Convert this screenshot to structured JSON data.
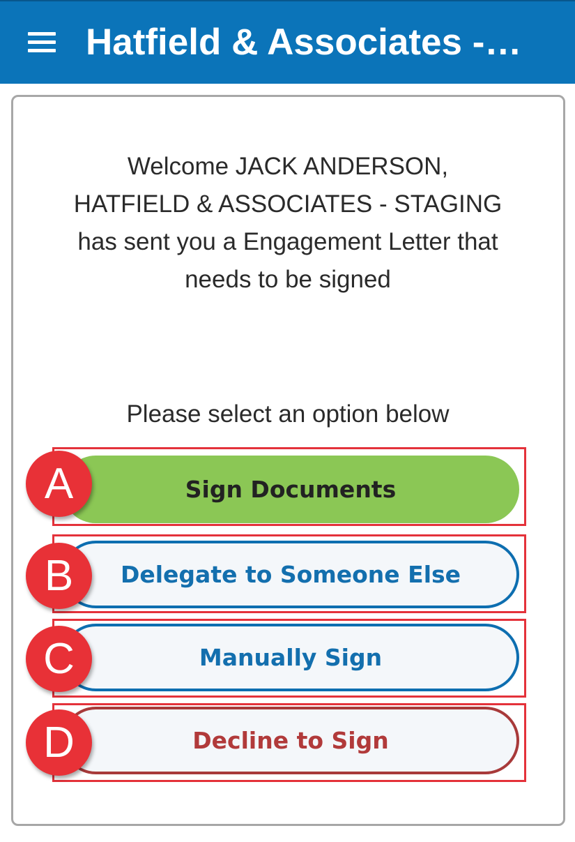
{
  "header": {
    "title": "Hatfield & Associates -…",
    "menu_icon": "hamburger-menu-icon"
  },
  "main": {
    "welcome_lines": [
      "Welcome JACK ANDERSON,",
      "HATFIELD & ASSOCIATES - STAGING",
      "has sent you a Engagement Letter that",
      "needs to be signed"
    ],
    "prompt": "Please select an option below"
  },
  "options": {
    "sign": {
      "badge": "A",
      "label": "Sign Documents"
    },
    "delegate": {
      "badge": "B",
      "label": "Delegate to Someone Else"
    },
    "manual": {
      "badge": "C",
      "label": "Manually Sign"
    },
    "decline": {
      "badge": "D",
      "label": "Decline to Sign"
    }
  },
  "colors": {
    "header_bg": "#0b74b9",
    "sign_button": "#8bc755",
    "outline_blue": "#0d6eb0",
    "outline_red": "#a83a3a",
    "annotation_red": "#e83137"
  }
}
